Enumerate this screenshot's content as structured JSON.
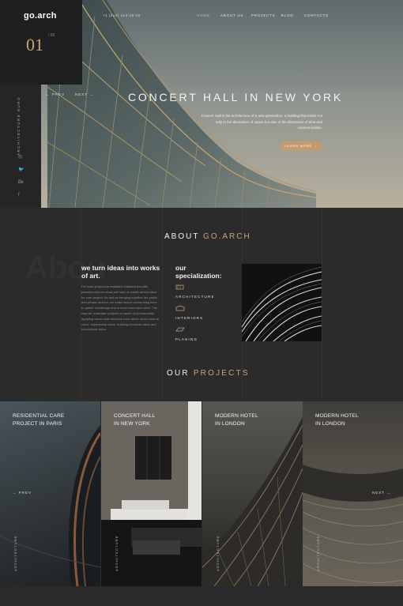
{
  "brand": {
    "logo": "go.arch",
    "slide_current": "01",
    "slide_total": "/ 03"
  },
  "header": {
    "phone": "+1 (212) 414-25-10",
    "nav": [
      "HOME",
      "ABOUT US",
      "PROJECTS",
      "BLOG",
      "CONTACTS"
    ]
  },
  "rail": {
    "vertical_text": "ARCHITECTURE BURO",
    "social": [
      "◎",
      "🐦",
      "Вк",
      "f"
    ]
  },
  "hero": {
    "prev": "← PREV",
    "next": "NEXT →",
    "title": "CONCERT HALL IN NEW YORK",
    "text": "Concert Hall is the architecture of a new generation, a building that exists not only in the dimension of space but also in the dimension of time and communication.",
    "button": "LEARN MORE →"
  },
  "about": {
    "title_prefix": "ABOUT ",
    "title_accent": "GO.ARCH",
    "ghost": "Abou",
    "turn_title": "we turn ideas into works of art.",
    "turn_text": "For each project we establish relationships with partners who we know will help us create added value for your project. As well as bringing together the public and private sectors, we make sector-overarching links to gather knowledge and to learn from each other. The way we undertake projects is based on permanently applying values that reinforce each other: socio-cultural value, experiential value, building-technical value and economical value.",
    "spec_title": "our specialization:",
    "specs": [
      "ARCHITECTURE",
      "INTERIORS",
      "PLANING"
    ]
  },
  "projects": {
    "title_prefix": "OUR ",
    "title_accent": "PROJECTS",
    "prev": "← PREV",
    "next": "NEXT →",
    "cards": [
      {
        "title": "RESIDENTIAL CARE\nPROJECT IN PARIS",
        "tag": "ARCHITECTURE"
      },
      {
        "title": "CONCERT HALL\nIN NEW YORK",
        "tag": "ARCHITECTURE"
      },
      {
        "title": "MODERN HOTEL\nIN LONDON",
        "tag": "ARCHITECTURE"
      },
      {
        "title": "MODERN HOTEL\nIN LONDON",
        "tag": "ARCHITECTURE"
      }
    ]
  },
  "colors": {
    "accent": "#c9a57a",
    "button": "#c49a6f",
    "dark": "#2b2b2b"
  }
}
